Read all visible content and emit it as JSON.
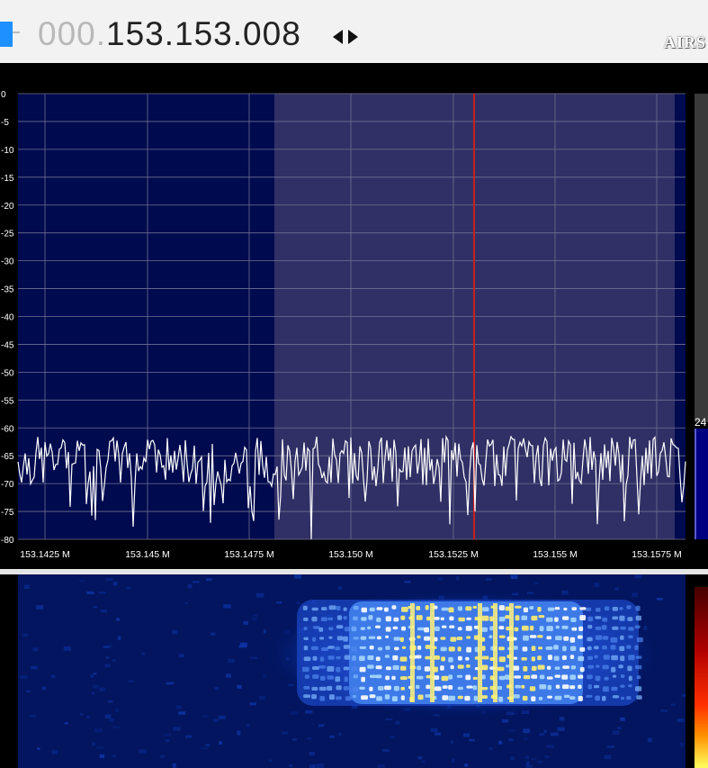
{
  "header": {
    "frequency_prefix": "000.",
    "frequency_value": "153.153.008",
    "logo_text": "AIRS"
  },
  "spectrum": {
    "db_labels": [
      "0",
      "-5",
      "-10",
      "-15",
      "-20",
      "-25",
      "-30",
      "-35",
      "-40",
      "-45",
      "-50",
      "-55",
      "-60",
      "-65",
      "-70",
      "-75",
      "-80"
    ],
    "freq_labels": [
      "153.1425 M",
      "153.145 M",
      "153.1475 M",
      "153.150 M",
      "153.1525 M",
      "153.155 M",
      "153.1575 M"
    ],
    "side_value": "24"
  },
  "colors": {
    "plot_bg": "#000a4e",
    "filter_band": "#303066",
    "trace": "#ffffff",
    "marker": "#cc1e1e"
  }
}
